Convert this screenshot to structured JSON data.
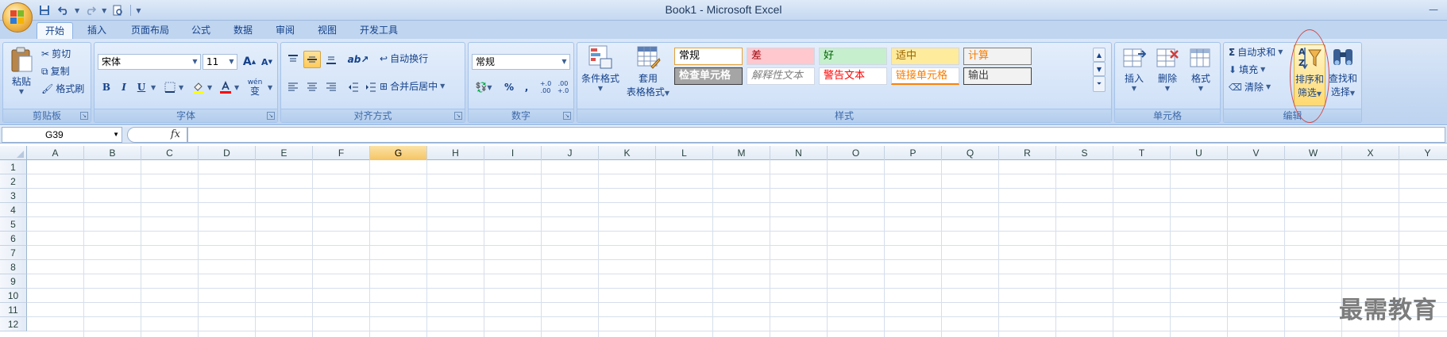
{
  "window": {
    "title": "Book1 - Microsoft Excel",
    "controls": [
      "minimize",
      "maximize",
      "close"
    ]
  },
  "quick_access": {
    "items": [
      {
        "icon": "save-icon"
      },
      {
        "icon": "undo-icon"
      },
      {
        "icon": "redo-icon"
      },
      {
        "icon": "print-preview-icon"
      }
    ]
  },
  "tabs": [
    {
      "label": "开始",
      "active": true
    },
    {
      "label": "插入"
    },
    {
      "label": "页面布局"
    },
    {
      "label": "公式"
    },
    {
      "label": "数据"
    },
    {
      "label": "审阅"
    },
    {
      "label": "视图"
    },
    {
      "label": "开发工具"
    }
  ],
  "ribbon": {
    "clipboard": {
      "label": "剪贴板",
      "paste": "粘贴",
      "cut": "剪切",
      "copy": "复制",
      "format_painter": "格式刷"
    },
    "font": {
      "label": "字体",
      "font_name": "宋体",
      "font_size": "11",
      "bold": "B",
      "italic": "I",
      "underline": "U",
      "grow": "A",
      "shrink": "A",
      "wen": "wén",
      "wen_char": "变"
    },
    "alignment": {
      "label": "对齐方式",
      "wrap_text": "自动换行",
      "merge_center": "合并后居中"
    },
    "number": {
      "label": "数字",
      "format": "常规",
      "percent": "%",
      "comma": ",",
      "inc_decimal": "+.0 .00",
      "dec_decimal": ".00 +.0"
    },
    "styles": {
      "label": "样式",
      "conditional_format": "条件格式",
      "format_as_table_1": "套用",
      "format_as_table_2": "表格格式",
      "cells": [
        {
          "text": "常规",
          "bg": "#ffffff",
          "color": "#000000",
          "border": "#e2a13a"
        },
        {
          "text": "差",
          "bg": "#ffc7ce",
          "color": "#9c0006"
        },
        {
          "text": "好",
          "bg": "#c6efce",
          "color": "#006100"
        },
        {
          "text": "适中",
          "bg": "#ffeb9c",
          "color": "#9c6500"
        },
        {
          "text": "计算",
          "bg": "#f2f2f2",
          "color": "#fa7d00",
          "border": "#7f7f7f"
        },
        {
          "text": "检查单元格",
          "bg": "#a5a5a5",
          "color": "#ffffff",
          "border": "#3f3f3f"
        },
        {
          "text": "解释性文本",
          "bg": "#ffffff",
          "color": "#7f7f7f",
          "italic": true
        },
        {
          "text": "警告文本",
          "bg": "#ffffff",
          "color": "#ff0000"
        },
        {
          "text": "链接单元格",
          "bg": "#ffffff",
          "color": "#fa7d00",
          "underline": "#ff8001"
        },
        {
          "text": "输出",
          "bg": "#f2f2f2",
          "color": "#3f3f3f",
          "border": "#3f3f3f"
        }
      ]
    },
    "cells_group": {
      "label": "单元格",
      "insert": "插入",
      "delete": "删除",
      "format": "格式"
    },
    "editing": {
      "label": "编辑",
      "autosum": "自动求和",
      "fill": "填充",
      "clear": "清除",
      "sort_filter_1": "排序和",
      "sort_filter_2": "筛选",
      "find_select_1": "查找和",
      "find_select_2": "选择"
    }
  },
  "formula_bar": {
    "name_box": "G39",
    "fx": "fx",
    "value": ""
  },
  "sheet": {
    "columns": [
      "A",
      "B",
      "C",
      "D",
      "E",
      "F",
      "G",
      "H",
      "I",
      "J",
      "K",
      "L",
      "M",
      "N",
      "O",
      "P",
      "Q",
      "R",
      "S",
      "T",
      "U",
      "V",
      "W",
      "X",
      "Y"
    ],
    "selected_column": "G",
    "rows": [
      "1",
      "2",
      "3",
      "4",
      "5",
      "6",
      "7",
      "8",
      "9",
      "10",
      "11",
      "12"
    ]
  },
  "watermark": "最需教育",
  "colors": {
    "accent": "#15428b",
    "selected_header": "#f5c463",
    "highlight_circle": "#d24a4a"
  }
}
